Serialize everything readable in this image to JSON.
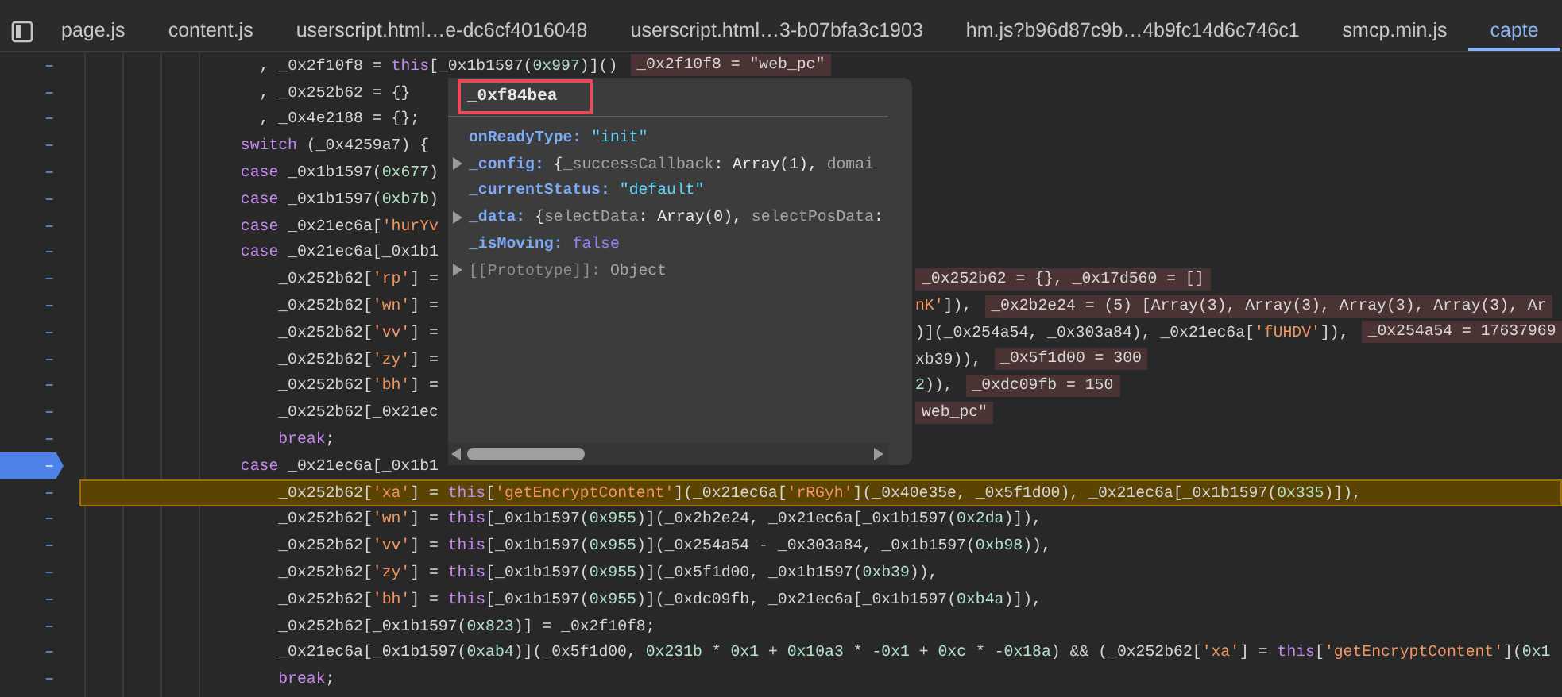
{
  "tabs": [
    {
      "label": "page.js",
      "selected": false
    },
    {
      "label": "content.js",
      "selected": false
    },
    {
      "label": "userscript.html…e-dc6cf4016048",
      "selected": false
    },
    {
      "label": "userscript.html…3-b07bfa3c1903",
      "selected": false
    },
    {
      "label": "hm.js?b96d87c9b…4b9fc14d6c746c1",
      "selected": false
    },
    {
      "label": "smcp.min.js",
      "selected": false
    },
    {
      "label": "capte",
      "selected": true
    }
  ],
  "code": {
    "lines": [
      {
        "gutter": "–",
        "text": "          , _0x2f10f8 = this[_0x1b1597(0x997)]()",
        "inline": "_0x2f10f8 = \"web_pc\"",
        "breakpoint": false,
        "current": false
      },
      {
        "gutter": "–",
        "text": "          , _0x252b62 = {}",
        "breakpoint": false,
        "current": false
      },
      {
        "gutter": "–",
        "text": "          , _0x4e2188 = {};",
        "breakpoint": false,
        "current": false
      },
      {
        "gutter": "–",
        "text": "        switch (_0x4259a7) {",
        "breakpoint": false,
        "current": false
      },
      {
        "gutter": "–",
        "text": "        case _0x1b1597(0x677)",
        "breakpoint": false,
        "current": false
      },
      {
        "gutter": "–",
        "text": "        case _0x1b1597(0xb7b)",
        "breakpoint": false,
        "current": false
      },
      {
        "gutter": "–",
        "text": "        case _0x21ec6a['hurYv",
        "breakpoint": false,
        "current": false
      },
      {
        "gutter": "–",
        "text": "        case _0x21ec6a[_0x1b1",
        "breakpoint": false,
        "current": false
      },
      {
        "gutter": "–",
        "text": "            _0x252b62['rp'] =",
        "after": {
          "inline": "_0x252b62 = {}, _0x17d560 = []"
        },
        "breakpoint": false,
        "current": false
      },
      {
        "gutter": "–",
        "text": "            _0x252b62['wn'] =",
        "after": {
          "code": "nK']),",
          "in_string": true,
          "inline": "_0x2b2e24 = (5) [Array(3), Array(3), Array(3), Array(3), Ar"
        },
        "breakpoint": false,
        "current": false
      },
      {
        "gutter": "–",
        "text": "            _0x252b62['vv'] =",
        "after": {
          "code": ")](_0x254a54, _0x303a84), _0x21ec6a['fUHDV']),",
          "in_string": false,
          "inline": "_0x254a54 = 17637969"
        },
        "breakpoint": false,
        "current": false
      },
      {
        "gutter": "–",
        "text": "            _0x252b62['zy'] =",
        "after": {
          "code": "xb39)),",
          "in_string": false,
          "inline": "_0x5f1d00 = 300"
        },
        "breakpoint": false,
        "current": false
      },
      {
        "gutter": "–",
        "text": "            _0x252b62['bh'] =",
        "after": {
          "code": "2)),",
          "in_string": false,
          "inline": "_0xdc09fb = 150"
        },
        "breakpoint": false,
        "current": false
      },
      {
        "gutter": "–",
        "text": "            _0x252b62[_0x21ec",
        "after": {
          "inline": "web_pc\""
        },
        "breakpoint": false,
        "current": false
      },
      {
        "gutter": "–",
        "text": "            break;",
        "breakpoint": false,
        "current": false
      },
      {
        "gutter": "–",
        "text": "        case _0x21ec6a[_0x1b1",
        "breakpoint": true,
        "current": false
      },
      {
        "gutter": "–",
        "text": "            _0x252b62['xa'] = this['getEncryptContent'](_0x21ec6a['rRGyh'](_0x40e35e, _0x5f1d00), _0x21ec6a[_0x1b1597(0x335)]),",
        "breakpoint": false,
        "current": true
      },
      {
        "gutter": "–",
        "text": "            _0x252b62['wn'] = this[_0x1b1597(0x955)](_0x2b2e24, _0x21ec6a[_0x1b1597(0x2da)]),",
        "breakpoint": false,
        "current": false
      },
      {
        "gutter": "–",
        "text": "            _0x252b62['vv'] = this[_0x1b1597(0x955)](_0x254a54 - _0x303a84, _0x1b1597(0xb98)),",
        "breakpoint": false,
        "current": false
      },
      {
        "gutter": "–",
        "text": "            _0x252b62['zy'] = this[_0x1b1597(0x955)](_0x5f1d00, _0x1b1597(0xb39)),",
        "breakpoint": false,
        "current": false
      },
      {
        "gutter": "–",
        "text": "            _0x252b62['bh'] = this[_0x1b1597(0x955)](_0xdc09fb, _0x21ec6a[_0x1b1597(0xb4a)]),",
        "breakpoint": false,
        "current": false
      },
      {
        "gutter": "–",
        "text": "            _0x252b62[_0x1b1597(0x823)] = _0x2f10f8;",
        "breakpoint": false,
        "current": false
      },
      {
        "gutter": "–",
        "text": "            _0x21ec6a[_0x1b1597(0xab4)](_0x5f1d00, 0x231b * 0x1 + 0x10a3 * -0x1 + 0xc * -0x18a) && (_0x252b62['xa'] = this['getEncryptContent'](0x1",
        "breakpoint": false,
        "current": false
      },
      {
        "gutter": "–",
        "text": "            break;",
        "breakpoint": false,
        "current": false
      }
    ]
  },
  "popover": {
    "title": "_0xf84bea",
    "properties": [
      {
        "key": "onReadyType:",
        "value": "\"init\"",
        "kind": "string",
        "expandable": false,
        "internal": false
      },
      {
        "key": "_config:",
        "value": "{_successCallback: Array(1), domai",
        "kind": "object",
        "expandable": true,
        "internal": false
      },
      {
        "key": "_currentStatus:",
        "value": "\"default\"",
        "kind": "string",
        "expandable": false,
        "internal": false
      },
      {
        "key": "_data:",
        "value": "{selectData: Array(0), selectPosData:",
        "kind": "object",
        "expandable": true,
        "internal": false
      },
      {
        "key": "_isMoving:",
        "value": "false",
        "kind": "boolean",
        "expandable": false,
        "internal": false
      },
      {
        "key": "[[Prototype]]:",
        "value": "Object",
        "kind": "object",
        "expandable": true,
        "internal": true
      }
    ]
  }
}
